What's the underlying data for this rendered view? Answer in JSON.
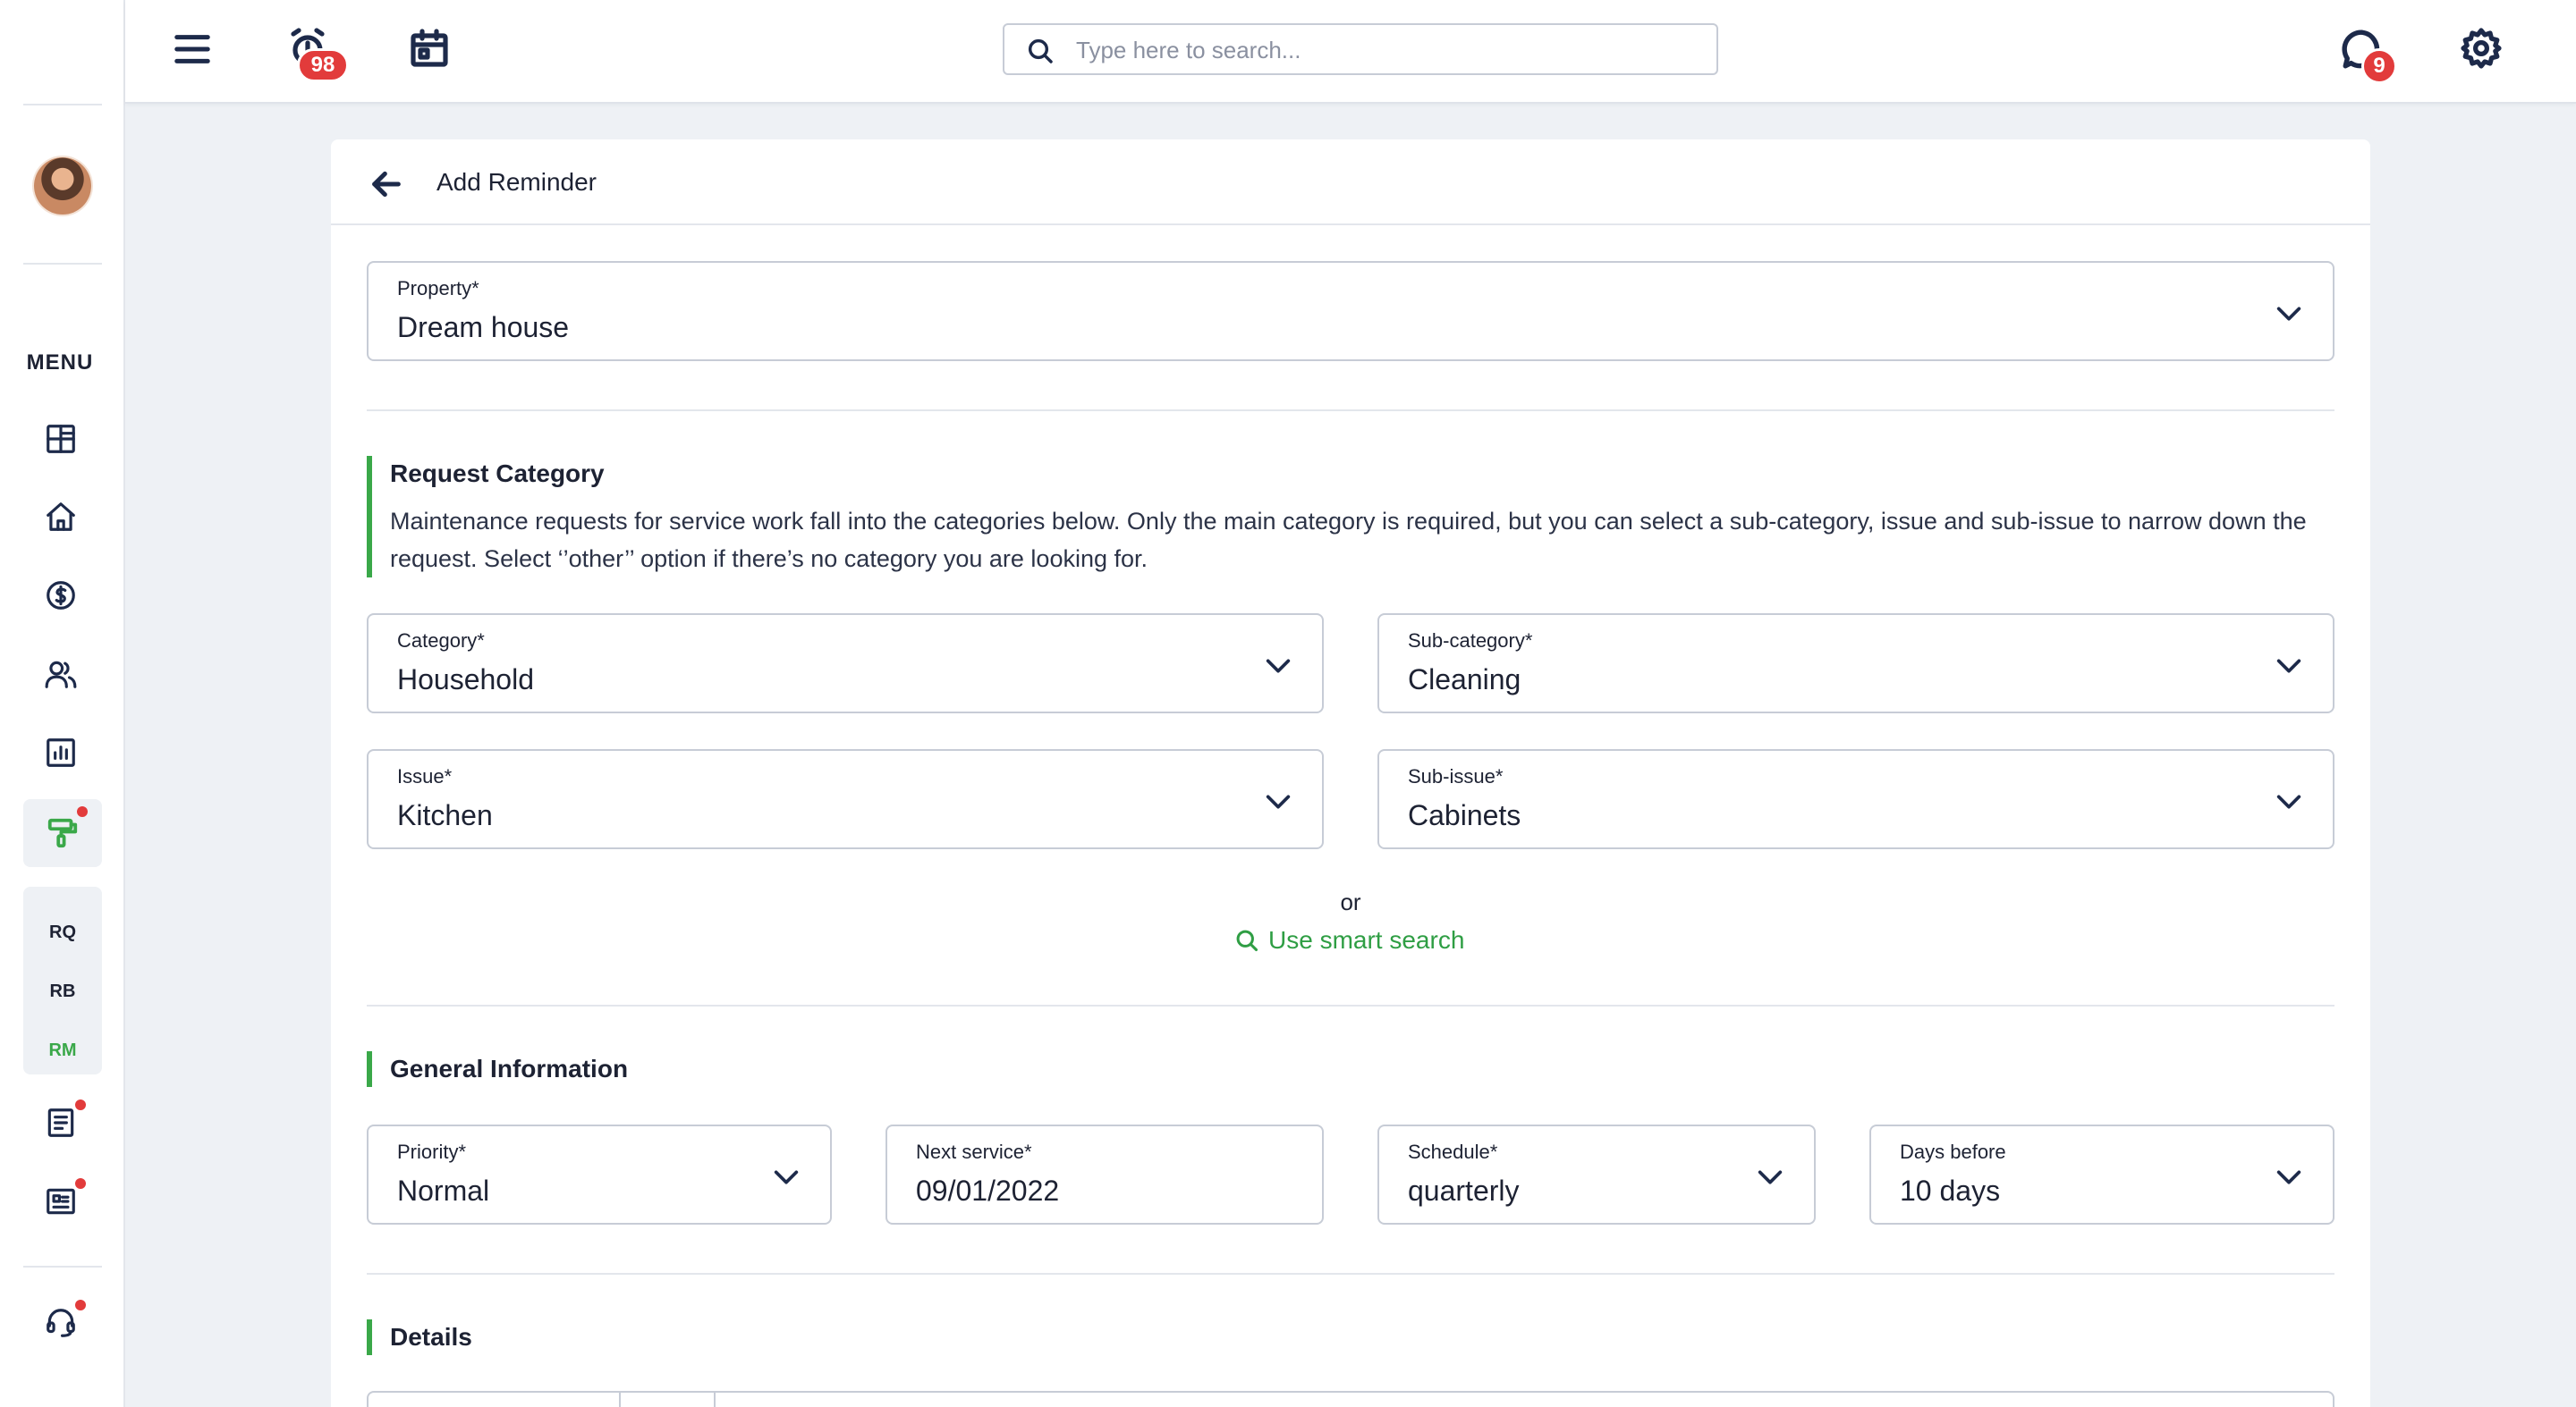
{
  "topbar": {
    "alarm_badge": "98",
    "chat_badge": "9",
    "search_placeholder": "Type here to search..."
  },
  "sidebar": {
    "menu_label": "MENU",
    "sub_items": [
      "RQ",
      "RB",
      "RM"
    ]
  },
  "page": {
    "title": "Add Reminder"
  },
  "property": {
    "label": "Property*",
    "value": "Dream house"
  },
  "request_category": {
    "title": "Request Category",
    "description": "Maintenance requests for service work fall into the categories below. Only the main category is required, but you can select a sub-category, issue and sub-issue to narrow down the request. Select ‘’other’’ option if there’s no category you are looking for.",
    "category": {
      "label": "Category*",
      "value": "Household"
    },
    "subcategory": {
      "label": "Sub-category*",
      "value": "Cleaning"
    },
    "issue": {
      "label": "Issue*",
      "value": "Kitchen"
    },
    "subissue": {
      "label": "Sub-issue*",
      "value": "Cabinets"
    },
    "or_text": "or",
    "smart_search": "Use smart search"
  },
  "general_information": {
    "title": "General Information",
    "priority": {
      "label": "Priority*",
      "value": "Normal"
    },
    "next_service": {
      "label": "Next service*",
      "value": "09/01/2022"
    },
    "schedule": {
      "label": "Schedule*",
      "value": "quarterly"
    },
    "days_before": {
      "label": "Days before",
      "value": "10 days"
    }
  },
  "details": {
    "title": "Details"
  },
  "colors": {
    "accent_green": "#3aa849",
    "badge_red": "#e23b3b",
    "navy": "#1d2a4a"
  }
}
